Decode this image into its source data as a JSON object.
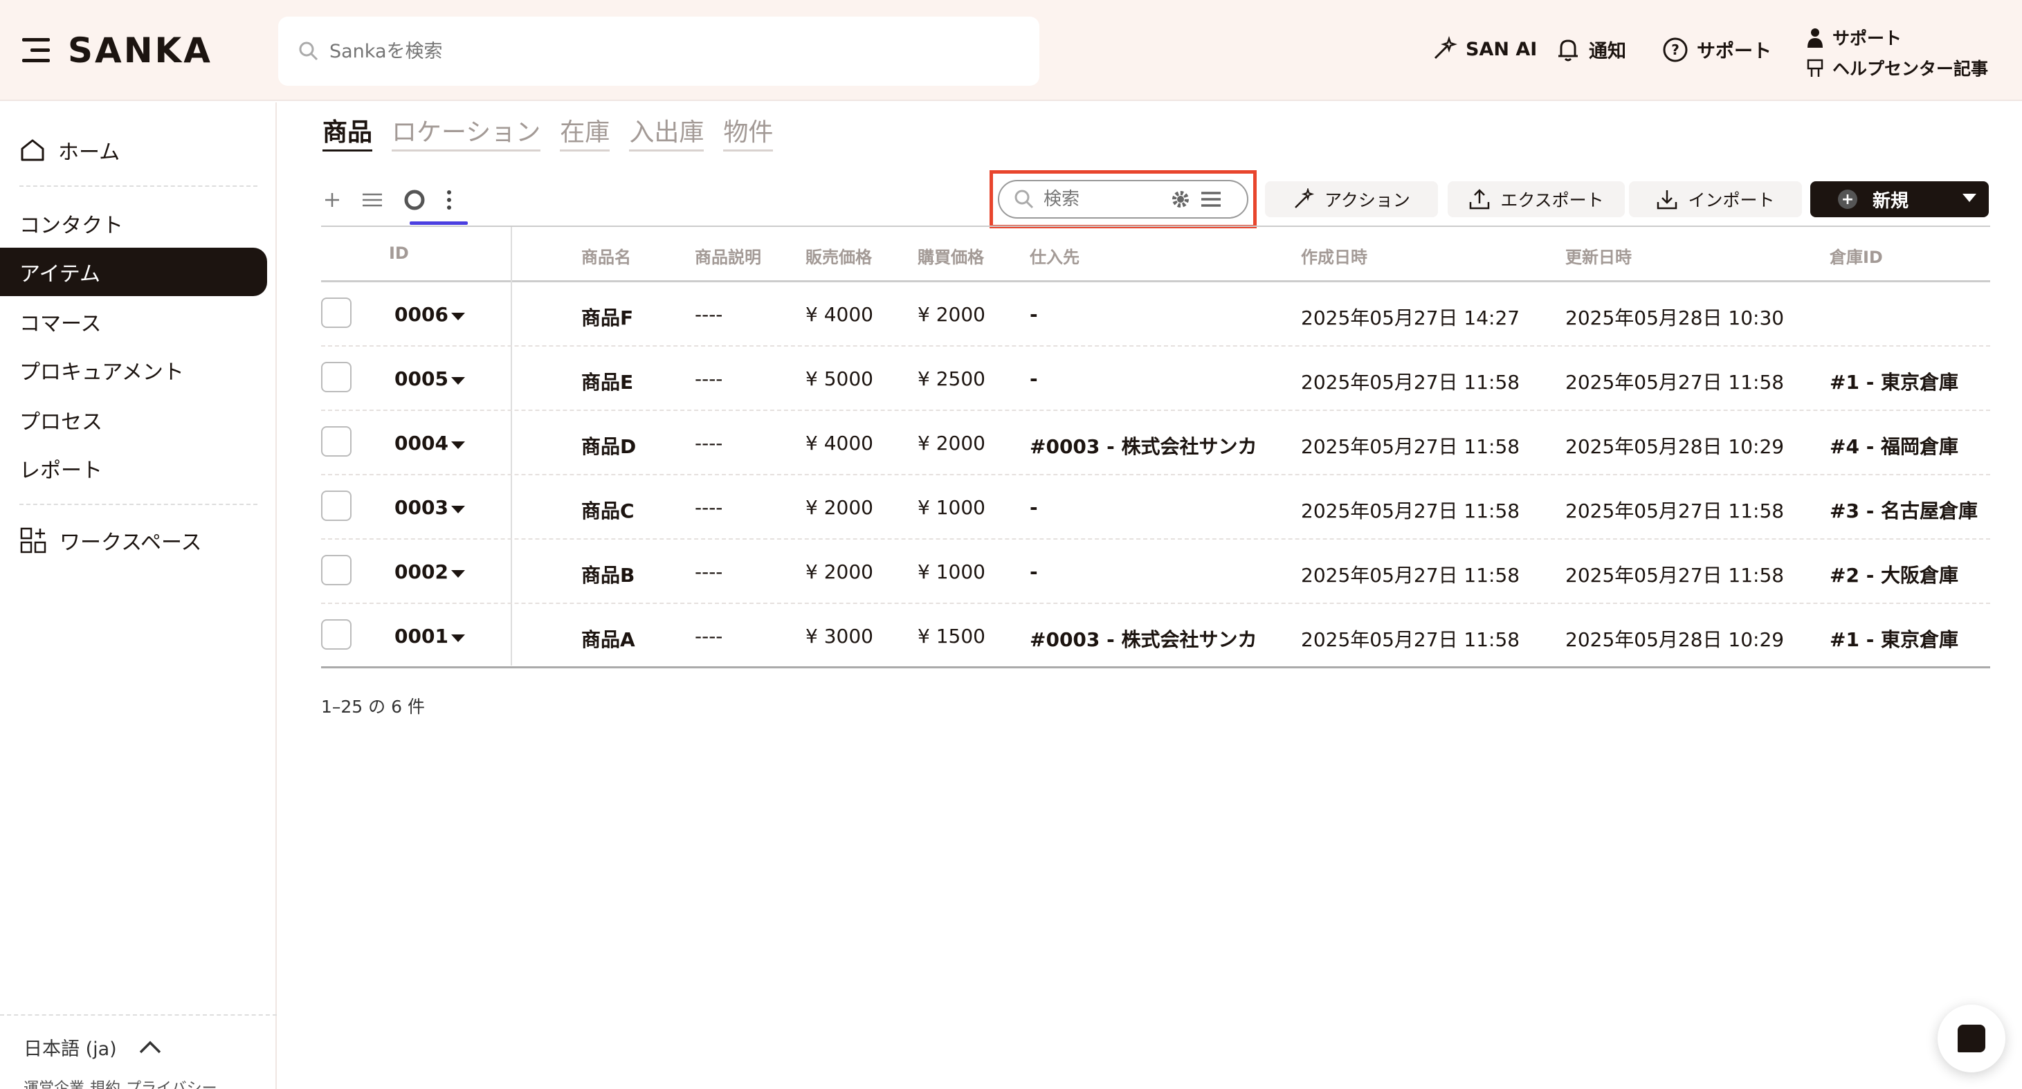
{
  "header": {
    "brand": "SANKA",
    "search_placeholder": "Sankaを検索",
    "san_ai": "SAN AI",
    "notifications": "通知",
    "support": "サポート",
    "support_top": "サポート",
    "help_center": "ヘルプセンター記事"
  },
  "sidebar": {
    "home": "ホーム",
    "items": [
      "コンタクト",
      "アイテム",
      "コマース",
      "プロキュアメント",
      "プロセス",
      "レポート"
    ],
    "active_index": 1,
    "workspace": "ワークスペース",
    "language": "日本語 (ja)",
    "footer_links": [
      "運営企業",
      "規約",
      "プライバシー"
    ]
  },
  "tabs": [
    {
      "label": "商品",
      "active": true
    },
    {
      "label": "ロケーション",
      "active": false
    },
    {
      "label": "在庫",
      "active": false
    },
    {
      "label": "入出庫",
      "active": false
    },
    {
      "label": "物件",
      "active": false
    }
  ],
  "toolbar": {
    "search_placeholder": "検索",
    "action": "アクション",
    "export": "エクスポート",
    "import": "インポート",
    "new": "新規"
  },
  "table": {
    "columns": [
      "ID",
      "商品名",
      "商品説明",
      "販売価格",
      "購買価格",
      "仕入先",
      "作成日時",
      "更新日時",
      "倉庫ID"
    ],
    "rows": [
      {
        "id": "0006",
        "name": "商品F",
        "desc": "----",
        "sell": "¥ 4000",
        "buy": "¥ 2000",
        "supplier": "-",
        "created": "2025年05月27日 14:27",
        "updated": "2025年05月28日 10:30",
        "warehouse": ""
      },
      {
        "id": "0005",
        "name": "商品E",
        "desc": "----",
        "sell": "¥ 5000",
        "buy": "¥ 2500",
        "supplier": "-",
        "created": "2025年05月27日 11:58",
        "updated": "2025年05月27日 11:58",
        "warehouse": "#1 - 東京倉庫"
      },
      {
        "id": "0004",
        "name": "商品D",
        "desc": "----",
        "sell": "¥ 4000",
        "buy": "¥ 2000",
        "supplier": "#0003 - 株式会社サンカ",
        "created": "2025年05月27日 11:58",
        "updated": "2025年05月28日 10:29",
        "warehouse": "#4 - 福岡倉庫"
      },
      {
        "id": "0003",
        "name": "商品C",
        "desc": "----",
        "sell": "¥ 2000",
        "buy": "¥ 1000",
        "supplier": "-",
        "created": "2025年05月27日 11:58",
        "updated": "2025年05月27日 11:58",
        "warehouse": "#3 - 名古屋倉庫"
      },
      {
        "id": "0002",
        "name": "商品B",
        "desc": "----",
        "sell": "¥ 2000",
        "buy": "¥ 1000",
        "supplier": "-",
        "created": "2025年05月27日 11:58",
        "updated": "2025年05月27日 11:58",
        "warehouse": "#2 - 大阪倉庫"
      },
      {
        "id": "0001",
        "name": "商品A",
        "desc": "----",
        "sell": "¥ 3000",
        "buy": "¥ 1500",
        "supplier": "#0003 - 株式会社サンカ",
        "created": "2025年05月27日 11:58",
        "updated": "2025年05月28日 10:29",
        "warehouse": "#1 - 東京倉庫"
      }
    ]
  },
  "pagination": "1–25 の 6 件",
  "colors": {
    "primary": "#1c1410",
    "header_bg": "#fcf3ef",
    "highlight": "#e8452d",
    "view_underline": "#4b3fe0"
  },
  "icons": [
    "menu-icon",
    "search-icon",
    "magic-wand-icon",
    "bell-icon",
    "help-circle-icon",
    "user-icon",
    "help-center-icon",
    "home-icon",
    "workspace-grid-icon",
    "chevron-up-icon",
    "plus-icon",
    "list-view-icon",
    "circle-view-icon",
    "more-vertical-icon",
    "gear-icon",
    "menu-lines-icon",
    "upload-icon",
    "download-icon",
    "caret-down-icon",
    "chat-icon"
  ]
}
